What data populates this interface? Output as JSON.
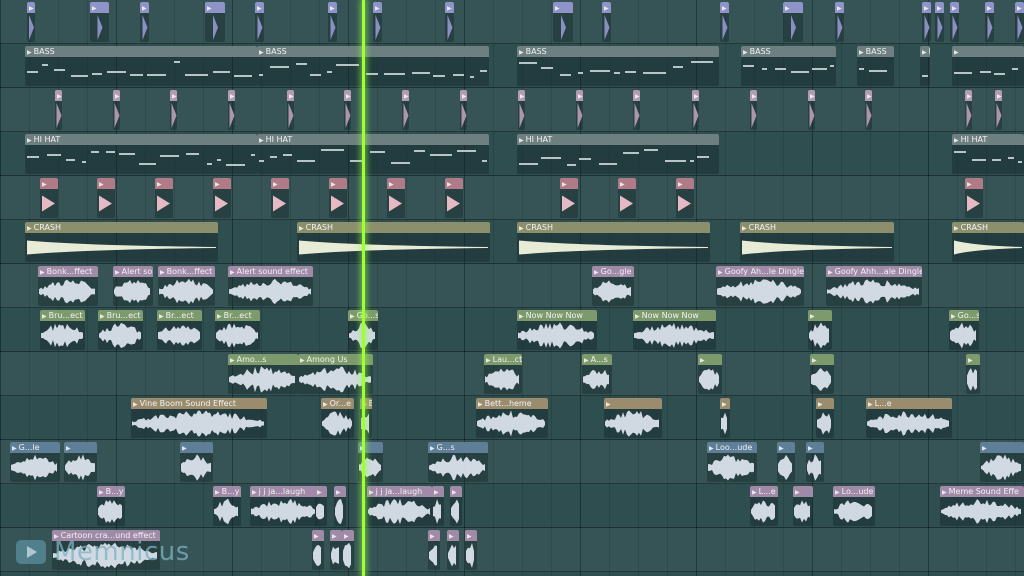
{
  "app": {
    "view": "Playlist"
  },
  "watermark": {
    "text": "Memnicus"
  },
  "rows": [
    {
      "kind": "kick",
      "color": "#8e94c8",
      "clips": [
        {
          "label": ""
        },
        {
          "label": ""
        },
        {
          "label": ""
        },
        {
          "label": ""
        },
        {
          "label": ""
        },
        {
          "label": ""
        },
        {
          "label": ""
        },
        {
          "label": ""
        },
        {
          "label": ""
        },
        {
          "label": ""
        },
        {
          "label": ""
        },
        {
          "label": ""
        },
        {
          "label": ""
        },
        {
          "label": ""
        },
        {
          "label": ""
        },
        {
          "label": ""
        },
        {
          "label": ""
        },
        {
          "label": ""
        },
        {
          "label": ""
        },
        {
          "label": ""
        },
        {
          "label": ""
        },
        {
          "label": ""
        }
      ]
    },
    {
      "kind": "bass",
      "color": "#6d7f80",
      "clips": [
        {
          "label": "BASS"
        },
        {
          "label": "BASS"
        },
        {
          "label": "BASS"
        },
        {
          "label": "BASS"
        },
        {
          "label": "BASS"
        },
        {
          "label": ""
        },
        {
          "label": "BASS"
        }
      ]
    },
    {
      "kind": "perc",
      "color": "#b39bb2",
      "clips": [
        {
          "label": ""
        },
        {
          "label": ""
        },
        {
          "label": ""
        },
        {
          "label": ""
        },
        {
          "label": ""
        },
        {
          "label": ""
        },
        {
          "label": ""
        },
        {
          "label": ""
        },
        {
          "label": ""
        },
        {
          "label": ""
        },
        {
          "label": ""
        },
        {
          "label": ""
        },
        {
          "label": ""
        },
        {
          "label": ""
        },
        {
          "label": ""
        },
        {
          "label": ""
        },
        {
          "label": ""
        }
      ]
    },
    {
      "kind": "hihat",
      "color": "#6d7f80",
      "clips": [
        {
          "label": "HI HAT"
        },
        {
          "label": "HI HAT"
        },
        {
          "label": "HI HAT"
        },
        {
          "label": "HI HAT"
        }
      ]
    },
    {
      "kind": "snare",
      "color": "#b07a86",
      "clips": [
        {
          "label": ""
        },
        {
          "label": ""
        },
        {
          "label": ""
        },
        {
          "label": ""
        },
        {
          "label": ""
        },
        {
          "label": ""
        },
        {
          "label": ""
        },
        {
          "label": ""
        },
        {
          "label": ""
        },
        {
          "label": ""
        },
        {
          "label": ""
        },
        {
          "label": ""
        }
      ]
    },
    {
      "kind": "crash",
      "color": "#8c8f6c",
      "clips": [
        {
          "label": "CRASH"
        },
        {
          "label": "CRASH"
        },
        {
          "label": "CRASH"
        },
        {
          "label": "CRASH"
        },
        {
          "label": "CRASH"
        }
      ]
    },
    {
      "kind": "fx1",
      "color": "#a08aa8",
      "clips": [
        {
          "label": "Bonk...ffect"
        },
        {
          "label": "Alert so"
        },
        {
          "label": "Bonk...ffect"
        },
        {
          "label": "Alert sound effect"
        },
        {
          "label": "Go...gle"
        },
        {
          "label": "Goofy Ah...le Dingle"
        },
        {
          "label": "Goofy Ahh...ale Dingle"
        }
      ]
    },
    {
      "kind": "fx2",
      "color": "#7d9a6c",
      "clips": [
        {
          "label": "Bru...ect"
        },
        {
          "label": "Bru...ect"
        },
        {
          "label": "Br...ect"
        },
        {
          "label": "Br...ect"
        },
        {
          "label": "Go...s"
        },
        {
          "label": "Now Now Now"
        },
        {
          "label": "Now Now Now"
        },
        {
          "label": ""
        },
        {
          "label": "Go...s"
        }
      ]
    },
    {
      "kind": "fx3",
      "color": "#7d9a6c",
      "clips": [
        {
          "label": "Amo...s"
        },
        {
          "label": "Among Us"
        },
        {
          "label": "Lau...ct"
        },
        {
          "label": "A...s"
        },
        {
          "label": ""
        },
        {
          "label": ""
        },
        {
          "label": ""
        }
      ]
    },
    {
      "kind": "fx4",
      "color": "#9a8c6c",
      "clips": [
        {
          "label": "Vine Boom Sound Effect"
        },
        {
          "label": "Or...e"
        },
        {
          "label": "Better...l Theme"
        },
        {
          "label": "Bett...heme"
        },
        {
          "label": ""
        },
        {
          "label": ""
        },
        {
          "label": ""
        },
        {
          "label": "L...e"
        }
      ]
    },
    {
      "kind": "fx5",
      "color": "#5f7f98",
      "clips": [
        {
          "label": "G...le"
        },
        {
          "label": ""
        },
        {
          "label": ""
        },
        {
          "label": ""
        },
        {
          "label": "G...s"
        },
        {
          "label": "Loo...ude"
        },
        {
          "label": ""
        },
        {
          "label": ""
        },
        {
          "label": ""
        }
      ]
    },
    {
      "kind": "fx6",
      "color": "#a08aa8",
      "clips": [
        {
          "label": "B...y"
        },
        {
          "label": "B...y"
        },
        {
          "label": "j j ja...laugh"
        },
        {
          "label": ""
        },
        {
          "label": ""
        },
        {
          "label": "j j ja...laugh"
        },
        {
          "label": ""
        },
        {
          "label": ""
        },
        {
          "label": "L...e"
        },
        {
          "label": ""
        },
        {
          "label": "Lo...ude"
        },
        {
          "label": "Meme Sound Effe"
        }
      ]
    },
    {
      "kind": "fx7",
      "color": "#a08aa8",
      "clips": [
        {
          "label": "Cartoon cra...und effect"
        },
        {
          "label": ""
        },
        {
          "label": ""
        },
        {
          "label": ""
        },
        {
          "label": ""
        },
        {
          "label": ""
        },
        {
          "label": ""
        }
      ]
    }
  ]
}
